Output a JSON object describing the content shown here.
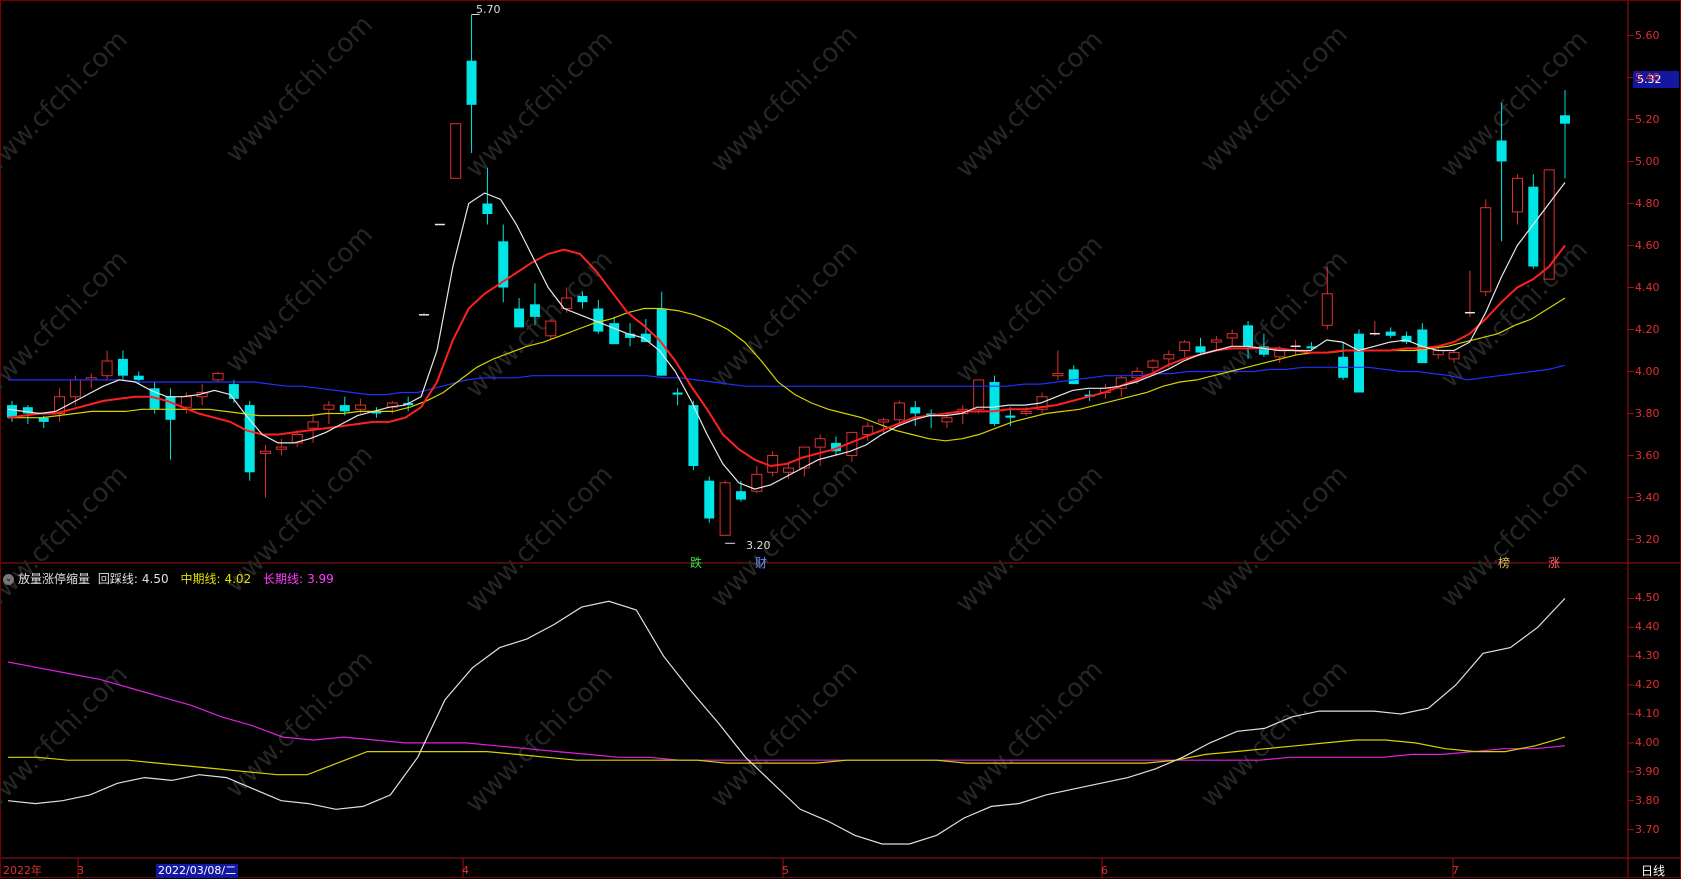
{
  "main_chart": {
    "y_ticks": [
      "5.60",
      "5.40",
      "5.20",
      "5.00",
      "4.80",
      "4.60",
      "4.40",
      "4.20",
      "4.00",
      "3.80",
      "3.60",
      "3.40",
      "3.20"
    ],
    "current_price": "5.32",
    "high_label": "5.70",
    "low_label": "3.20",
    "signals": [
      {
        "text": "跌",
        "color": "#40e040"
      },
      {
        "text": "财",
        "color": "#6090ff"
      },
      {
        "text": "榜",
        "color": "#e8c060"
      },
      {
        "text": "涨",
        "color": "#ff6060"
      }
    ],
    "colors": {
      "up": "#e03030",
      "down": "#00e5e5",
      "ma_white": "#e8e8e8",
      "ma_red": "#ff2020",
      "ma_yellow": "#d4d400",
      "ma_blue": "#2030ff"
    }
  },
  "indicator": {
    "name": "放量涨停缩量",
    "l1_label": "回踩线:",
    "l1_value": "4.50",
    "l2_label": "中期线:",
    "l2_value": "4.02",
    "l3_label": "长期线:",
    "l3_value": "3.99",
    "y_ticks": [
      "4.50",
      "4.40",
      "4.30",
      "4.20",
      "4.10",
      "4.00",
      "3.90",
      "3.80",
      "3.70"
    ]
  },
  "x_axis": {
    "labels": [
      "2022年",
      "3",
      "2022/03/08/二",
      "4",
      "5",
      "6",
      "7"
    ],
    "period": "日线"
  },
  "watermark": "www.cfchi.com",
  "chart_data": {
    "type": "candlestick",
    "y_range_main": [
      3.15,
      5.75
    ],
    "y_range_indicator": [
      3.65,
      4.55
    ],
    "candles": [
      [
        3.84,
        3.86,
        3.76,
        3.78
      ],
      [
        3.83,
        3.84,
        3.75,
        3.8
      ],
      [
        3.78,
        3.79,
        3.73,
        3.76
      ],
      [
        3.8,
        3.92,
        3.76,
        3.88
      ],
      [
        3.88,
        3.98,
        3.84,
        3.96
      ],
      [
        3.96,
        3.99,
        3.92,
        3.97
      ],
      [
        3.98,
        4.1,
        3.96,
        4.05
      ],
      [
        4.06,
        4.1,
        3.96,
        3.98
      ],
      [
        3.98,
        4.0,
        3.94,
        3.96
      ],
      [
        3.92,
        3.95,
        3.8,
        3.82
      ],
      [
        3.88,
        3.92,
        3.58,
        3.77
      ],
      [
        3.83,
        3.9,
        3.8,
        3.88
      ],
      [
        3.88,
        3.94,
        3.84,
        3.9
      ],
      [
        3.96,
        4.0,
        3.95,
        3.99
      ],
      [
        3.94,
        3.96,
        3.85,
        3.87
      ],
      [
        3.84,
        3.86,
        3.48,
        3.52
      ],
      [
        3.61,
        3.65,
        3.4,
        3.62
      ],
      [
        3.63,
        3.68,
        3.6,
        3.64
      ],
      [
        3.66,
        3.72,
        3.64,
        3.7
      ],
      [
        3.73,
        3.8,
        3.66,
        3.76
      ],
      [
        3.82,
        3.86,
        3.75,
        3.84
      ],
      [
        3.84,
        3.88,
        3.79,
        3.81
      ],
      [
        3.82,
        3.87,
        3.8,
        3.84
      ],
      [
        3.81,
        3.83,
        3.78,
        3.8
      ],
      [
        3.83,
        3.86,
        3.8,
        3.85
      ],
      [
        3.85,
        3.88,
        3.81,
        3.84
      ],
      [
        4.27,
        4.28,
        4.27,
        4.27
      ],
      [
        4.7,
        4.7,
        4.7,
        4.7
      ],
      [
        4.92,
        5.18,
        4.92,
        5.18
      ],
      [
        5.48,
        5.7,
        5.04,
        5.27
      ],
      [
        4.8,
        4.97,
        4.7,
        4.75
      ],
      [
        4.62,
        4.7,
        4.33,
        4.4
      ],
      [
        4.3,
        4.35,
        4.21,
        4.21
      ],
      [
        4.32,
        4.42,
        4.22,
        4.26
      ],
      [
        4.17,
        4.25,
        4.15,
        4.24
      ],
      [
        4.3,
        4.4,
        4.28,
        4.35
      ],
      [
        4.36,
        4.38,
        4.3,
        4.33
      ],
      [
        4.3,
        4.34,
        4.18,
        4.19
      ],
      [
        4.23,
        4.26,
        4.14,
        4.13
      ],
      [
        4.18,
        4.23,
        4.12,
        4.16
      ],
      [
        4.18,
        4.25,
        4.15,
        4.14
      ],
      [
        4.3,
        4.38,
        3.98,
        3.98
      ],
      [
        3.9,
        3.92,
        3.84,
        3.89
      ],
      [
        3.84,
        3.86,
        3.53,
        3.55
      ],
      [
        3.48,
        3.5,
        3.28,
        3.3
      ],
      [
        3.22,
        3.48,
        3.22,
        3.47
      ],
      [
        3.43,
        3.48,
        3.38,
        3.39
      ],
      [
        3.43,
        3.55,
        3.42,
        3.51
      ],
      [
        3.52,
        3.62,
        3.5,
        3.6
      ],
      [
        3.52,
        3.57,
        3.49,
        3.54
      ],
      [
        3.54,
        3.64,
        3.5,
        3.64
      ],
      [
        3.64,
        3.7,
        3.55,
        3.68
      ],
      [
        3.66,
        3.69,
        3.6,
        3.62
      ],
      [
        3.6,
        3.7,
        3.57,
        3.71
      ],
      [
        3.7,
        3.76,
        3.67,
        3.74
      ],
      [
        3.76,
        3.78,
        3.7,
        3.77
      ],
      [
        3.77,
        3.86,
        3.74,
        3.85
      ],
      [
        3.83,
        3.86,
        3.74,
        3.8
      ],
      [
        3.8,
        3.82,
        3.73,
        3.79
      ],
      [
        3.76,
        3.8,
        3.73,
        3.78
      ],
      [
        3.8,
        3.84,
        3.75,
        3.82
      ],
      [
        3.82,
        3.96,
        3.8,
        3.96
      ],
      [
        3.95,
        3.98,
        3.74,
        3.75
      ],
      [
        3.79,
        3.83,
        3.74,
        3.78
      ],
      [
        3.8,
        3.83,
        3.79,
        3.81
      ],
      [
        3.82,
        3.9,
        3.8,
        3.88
      ],
      [
        3.98,
        4.1,
        3.96,
        3.99
      ],
      [
        4.01,
        4.03,
        3.96,
        3.94
      ],
      [
        3.89,
        3.91,
        3.86,
        3.88
      ],
      [
        3.9,
        3.94,
        3.87,
        3.92
      ],
      [
        3.92,
        3.98,
        3.88,
        3.97
      ],
      [
        3.97,
        4.02,
        3.94,
        4.0
      ],
      [
        4.02,
        4.06,
        3.99,
        4.05
      ],
      [
        4.06,
        4.1,
        4.02,
        4.08
      ],
      [
        4.1,
        4.15,
        4.07,
        4.14
      ],
      [
        4.12,
        4.16,
        4.08,
        4.09
      ],
      [
        4.14,
        4.17,
        4.1,
        4.15
      ],
      [
        4.16,
        4.2,
        4.12,
        4.18
      ],
      [
        4.22,
        4.24,
        4.06,
        4.12
      ],
      [
        4.12,
        4.18,
        4.07,
        4.08
      ],
      [
        4.07,
        4.12,
        4.04,
        4.1
      ],
      [
        4.12,
        4.15,
        4.08,
        4.12
      ],
      [
        4.12,
        4.14,
        4.1,
        4.11
      ],
      [
        4.22,
        4.5,
        4.2,
        4.37
      ],
      [
        4.07,
        4.14,
        3.96,
        3.97
      ],
      [
        4.18,
        4.2,
        3.9,
        3.9
      ],
      [
        4.18,
        4.24,
        4.17,
        4.18
      ],
      [
        4.19,
        4.21,
        4.16,
        4.17
      ],
      [
        4.17,
        4.19,
        4.13,
        4.14
      ],
      [
        4.2,
        4.23,
        4.15,
        4.04
      ],
      [
        4.08,
        4.11,
        4.06,
        4.1
      ],
      [
        4.06,
        4.1,
        4.04,
        4.09
      ],
      [
        4.28,
        4.48,
        4.26,
        4.28
      ],
      [
        4.38,
        4.82,
        4.36,
        4.78
      ],
      [
        5.1,
        5.28,
        4.62,
        5.0
      ],
      [
        4.76,
        4.94,
        4.7,
        4.92
      ],
      [
        4.88,
        4.94,
        4.49,
        4.5
      ],
      [
        4.44,
        4.96,
        4.44,
        4.96
      ],
      [
        5.22,
        5.34,
        4.92,
        5.18
      ]
    ],
    "ma_white": [
      3.82,
      3.81,
      3.8,
      3.81,
      3.85,
      3.89,
      3.93,
      3.96,
      3.95,
      3.91,
      3.88,
      3.88,
      3.89,
      3.91,
      3.89,
      3.79,
      3.7,
      3.66,
      3.66,
      3.68,
      3.71,
      3.75,
      3.79,
      3.81,
      3.83,
      3.84,
      3.88,
      4.1,
      4.5,
      4.8,
      4.85,
      4.82,
      4.7,
      4.55,
      4.4,
      4.3,
      4.27,
      4.24,
      4.21,
      4.18,
      4.16,
      4.1,
      4.0,
      3.86,
      3.7,
      3.56,
      3.47,
      3.44,
      3.46,
      3.5,
      3.54,
      3.58,
      3.6,
      3.62,
      3.65,
      3.7,
      3.74,
      3.77,
      3.79,
      3.79,
      3.8,
      3.83,
      3.83,
      3.84,
      3.84,
      3.85,
      3.88,
      3.91,
      3.92,
      3.92,
      3.93,
      3.95,
      3.98,
      4.01,
      4.05,
      4.08,
      4.1,
      4.12,
      4.12,
      4.11,
      4.1,
      4.1,
      4.1,
      4.15,
      4.14,
      4.1,
      4.12,
      4.14,
      4.15,
      4.12,
      4.1,
      4.1,
      4.14,
      4.28,
      4.45,
      4.6,
      4.7,
      4.8,
      4.9
    ],
    "ma_red": [
      3.78,
      3.79,
      3.8,
      3.8,
      3.82,
      3.84,
      3.86,
      3.87,
      3.88,
      3.88,
      3.86,
      3.83,
      3.8,
      3.78,
      3.76,
      3.72,
      3.7,
      3.7,
      3.71,
      3.72,
      3.73,
      3.74,
      3.75,
      3.76,
      3.76,
      3.78,
      3.83,
      3.95,
      4.15,
      4.3,
      4.37,
      4.42,
      4.47,
      4.52,
      4.56,
      4.58,
      4.56,
      4.48,
      4.38,
      4.28,
      4.22,
      4.15,
      4.05,
      3.93,
      3.82,
      3.7,
      3.63,
      3.58,
      3.55,
      3.56,
      3.59,
      3.61,
      3.63,
      3.66,
      3.69,
      3.72,
      3.75,
      3.78,
      3.79,
      3.8,
      3.81,
      3.81,
      3.81,
      3.82,
      3.82,
      3.83,
      3.84,
      3.86,
      3.88,
      3.9,
      3.93,
      3.96,
      3.99,
      4.03,
      4.06,
      4.08,
      4.1,
      4.11,
      4.11,
      4.11,
      4.11,
      4.1,
      4.09,
      4.09,
      4.1,
      4.1,
      4.1,
      4.1,
      4.11,
      4.11,
      4.12,
      4.14,
      4.18,
      4.25,
      4.33,
      4.4,
      4.44,
      4.5,
      4.6
    ],
    "ma_yellow": [
      3.78,
      3.78,
      3.78,
      3.79,
      3.8,
      3.81,
      3.81,
      3.81,
      3.82,
      3.82,
      3.82,
      3.82,
      3.82,
      3.81,
      3.8,
      3.79,
      3.79,
      3.79,
      3.79,
      3.8,
      3.8,
      3.81,
      3.81,
      3.81,
      3.83,
      3.86,
      3.9,
      3.96,
      4.02,
      4.06,
      4.09,
      4.12,
      4.14,
      4.17,
      4.2,
      4.23,
      4.25,
      4.28,
      4.3,
      4.3,
      4.29,
      4.27,
      4.24,
      4.2,
      4.14,
      4.05,
      3.95,
      3.89,
      3.85,
      3.82,
      3.8,
      3.78,
      3.75,
      3.72,
      3.7,
      3.68,
      3.67,
      3.68,
      3.7,
      3.73,
      3.76,
      3.78,
      3.8,
      3.81,
      3.82,
      3.84,
      3.86,
      3.88,
      3.9,
      3.93,
      3.95,
      3.96,
      3.98,
      4.0,
      4.02,
      4.04,
      4.06,
      4.08,
      4.09,
      4.09,
      4.1,
      4.1,
      4.1,
      4.1,
      4.1,
      4.11,
      4.12,
      4.14,
      4.16,
      4.18,
      4.22,
      4.25,
      4.3,
      4.35
    ],
    "ma_blue": [
      3.96,
      3.96,
      3.96,
      3.96,
      3.96,
      3.96,
      3.96,
      3.96,
      3.95,
      3.95,
      3.95,
      3.95,
      3.95,
      3.95,
      3.95,
      3.95,
      3.94,
      3.93,
      3.93,
      3.92,
      3.91,
      3.9,
      3.89,
      3.89,
      3.9,
      3.9,
      3.92,
      3.94,
      3.96,
      3.97,
      3.97,
      3.97,
      3.98,
      3.98,
      3.98,
      3.98,
      3.98,
      3.98,
      3.98,
      3.98,
      3.97,
      3.97,
      3.96,
      3.95,
      3.94,
      3.93,
      3.93,
      3.93,
      3.93,
      3.93,
      3.93,
      3.93,
      3.93,
      3.93,
      3.93,
      3.93,
      3.93,
      3.93,
      3.93,
      3.93,
      3.93,
      3.93,
      3.94,
      3.94,
      3.95,
      3.96,
      3.97,
      3.98,
      3.98,
      3.98,
      3.99,
      3.99,
      4.0,
      4.0,
      4.0,
      4.0,
      4.0,
      4.01,
      4.01,
      4.02,
      4.02,
      4.02,
      4.02,
      4.02,
      4.01,
      4.0,
      4.0,
      3.99,
      3.98,
      3.96,
      3.97,
      3.98,
      3.99,
      4.0,
      4.01,
      4.03
    ],
    "ind_white": [
      3.8,
      3.79,
      3.8,
      3.82,
      3.86,
      3.88,
      3.87,
      3.89,
      3.88,
      3.84,
      3.8,
      3.79,
      3.77,
      3.78,
      3.82,
      3.95,
      4.15,
      4.26,
      4.33,
      4.36,
      4.41,
      4.47,
      4.49,
      4.46,
      4.3,
      4.18,
      4.07,
      3.95,
      3.86,
      3.77,
      3.73,
      3.68,
      3.65,
      3.65,
      3.68,
      3.74,
      3.78,
      3.79,
      3.82,
      3.84,
      3.86,
      3.88,
      3.91,
      3.95,
      4.0,
      4.04,
      4.05,
      4.09,
      4.11,
      4.11,
      4.11,
      4.1,
      4.12,
      4.2,
      4.31,
      4.33,
      4.4,
      4.5
    ],
    "ind_yellow": [
      3.95,
      3.95,
      3.94,
      3.94,
      3.94,
      3.93,
      3.92,
      3.91,
      3.9,
      3.89,
      3.89,
      3.93,
      3.97,
      3.97,
      3.97,
      3.97,
      3.97,
      3.96,
      3.95,
      3.94,
      3.94,
      3.94,
      3.94,
      3.94,
      3.93,
      3.93,
      3.93,
      3.93,
      3.94,
      3.94,
      3.94,
      3.94,
      3.93,
      3.93,
      3.93,
      3.93,
      3.93,
      3.93,
      3.93,
      3.94,
      3.96,
      3.97,
      3.98,
      3.99,
      4.0,
      4.01,
      4.01,
      4.0,
      3.98,
      3.97,
      3.97,
      3.99,
      4.02
    ],
    "ind_magenta": [
      4.28,
      4.26,
      4.24,
      4.22,
      4.19,
      4.16,
      4.13,
      4.09,
      4.06,
      4.02,
      4.01,
      4.02,
      4.01,
      4.0,
      4.0,
      4.0,
      3.99,
      3.98,
      3.97,
      3.96,
      3.95,
      3.95,
      3.94,
      3.94,
      3.94,
      3.94,
      3.94,
      3.94,
      3.94,
      3.94,
      3.94,
      3.94,
      3.94,
      3.94,
      3.94,
      3.94,
      3.94,
      3.94,
      3.94,
      3.94,
      3.94,
      3.94,
      3.95,
      3.95,
      3.95,
      3.95,
      3.96,
      3.96,
      3.97,
      3.98,
      3.98,
      3.99
    ]
  }
}
